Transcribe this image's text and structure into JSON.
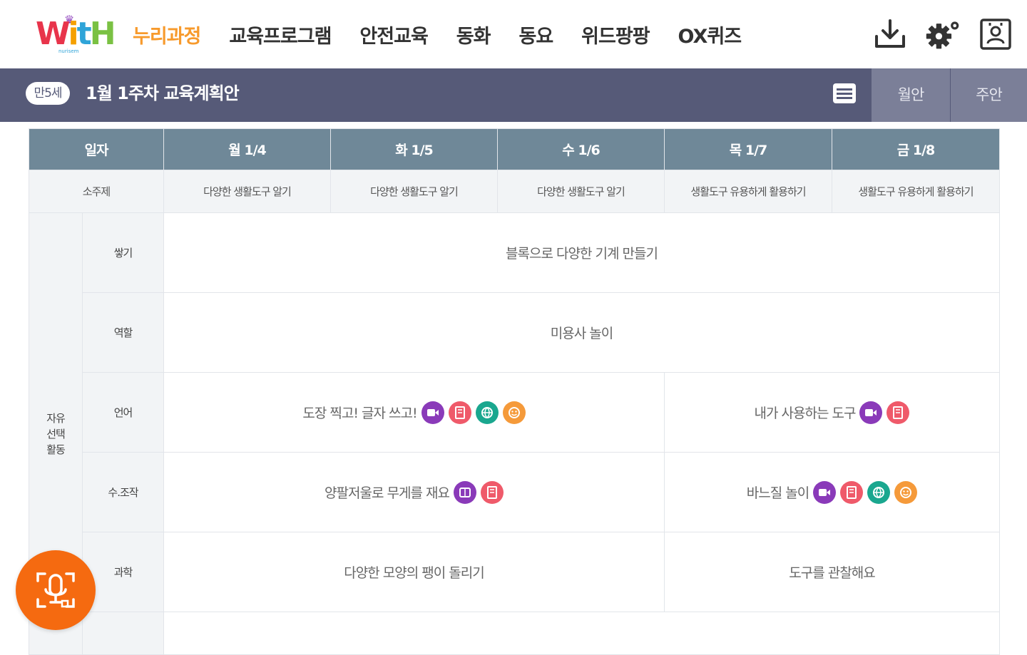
{
  "header": {
    "logo": {
      "text": "WitH",
      "sub": "nurisem"
    },
    "nav": [
      {
        "label": "누리과정",
        "active": true
      },
      {
        "label": "교육프로그램",
        "active": false
      },
      {
        "label": "안전교육",
        "active": false
      },
      {
        "label": "동화",
        "active": false
      },
      {
        "label": "동요",
        "active": false
      },
      {
        "label": "위드팡팡",
        "active": false
      },
      {
        "label": "OX퀴즈",
        "active": false
      }
    ],
    "icons": [
      "download-icon",
      "settings-icon",
      "profile-icon"
    ],
    "accent_color": "#f79a2c"
  },
  "titlebar": {
    "age_badge": "만5세",
    "title": "1월 1주차 교육계획안",
    "tabs": {
      "monthly": "월안",
      "weekly": "주안"
    },
    "background": "#565a78"
  },
  "table": {
    "headers": [
      "일자",
      "월 1/4",
      "화 1/5",
      "수 1/6",
      "목 1/7",
      "금 1/8"
    ],
    "subtopic": {
      "label": "소주제",
      "values": [
        "다양한 생활도구 알기",
        "다양한 생활도구 알기",
        "다양한 생활도구 알기",
        "생활도구 유용하게 활용하기",
        "생활도구 유용하게 활용하기"
      ]
    },
    "category": "자유 선택 활동",
    "rows": [
      {
        "label": "쌓기",
        "full": "블록으로 다양한 기계 만들기"
      },
      {
        "label": "역할",
        "full": "미용사 놀이"
      },
      {
        "label": "언어",
        "left": {
          "text": "도장 찍고! 글자 쓰고!",
          "icons": [
            "video-icon",
            "book-icon",
            "globe-icon",
            "face-icon"
          ]
        },
        "right": {
          "text": "내가 사용하는 도구",
          "icons": [
            "video-icon",
            "book-icon"
          ]
        }
      },
      {
        "label": "수.조작",
        "left": {
          "text": "양팔저울로 무게를 재요",
          "icons": [
            "ebook-icon",
            "book-icon"
          ]
        },
        "right": {
          "text": "바느질 놀이",
          "icons": [
            "video-icon",
            "book-icon",
            "globe-icon",
            "face-icon"
          ]
        }
      },
      {
        "label": "과학",
        "left": {
          "text": "다양한 모양의 팽이 돌리기",
          "icons": []
        },
        "right": {
          "text": "도구를 관찰해요",
          "icons": []
        }
      }
    ]
  },
  "fab": {
    "icon": "voice-mic-icon",
    "color": "#f56a10"
  }
}
